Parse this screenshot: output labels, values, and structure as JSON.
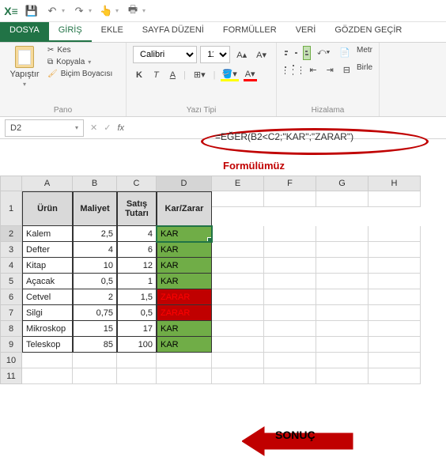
{
  "qat": {
    "save": "💾",
    "undo": "↶",
    "redo": "↷"
  },
  "tabs": {
    "dosya": "DOSYA",
    "giris": "GİRİŞ",
    "ekle": "EKLE",
    "sayfa": "SAYFA DÜZENİ",
    "formuller": "FORMÜLLER",
    "veri": "VERİ",
    "gozden": "GÖZDEN GEÇİR"
  },
  "ribbon": {
    "paste": "Yapıştır",
    "cut": "Kes",
    "copy": "Kopyala",
    "format_painter": "Biçim Boyacısı",
    "font_name": "Calibri",
    "font_size": "11",
    "merge": "Metr",
    "wrap": "Birle",
    "group_pano": "Pano",
    "group_font": "Yazı Tipi",
    "group_align": "Hizalama"
  },
  "namebox": "D2",
  "formula": "=EĞER(B2<C2;\"KAR\";\"ZARAR\")",
  "annotations": {
    "formula_label": "Formülümüz",
    "result_label": "SONUÇ"
  },
  "columns": [
    "A",
    "B",
    "C",
    "D",
    "E",
    "F",
    "G",
    "H"
  ],
  "header_row": {
    "urun": "Ürün",
    "maliyet": "Maliyet",
    "satis": "Satış Tutarı",
    "kz": "Kar/Zarar"
  },
  "rows": [
    {
      "n": 2,
      "urun": "Kalem",
      "maliyet": "2,5",
      "satis": "4",
      "kz": "KAR",
      "cls": "kar"
    },
    {
      "n": 3,
      "urun": "Defter",
      "maliyet": "4",
      "satis": "6",
      "kz": "KAR",
      "cls": "kar"
    },
    {
      "n": 4,
      "urun": "Kitap",
      "maliyet": "10",
      "satis": "12",
      "kz": "KAR",
      "cls": "kar"
    },
    {
      "n": 5,
      "urun": "Açacak",
      "maliyet": "0,5",
      "satis": "1",
      "kz": "KAR",
      "cls": "kar"
    },
    {
      "n": 6,
      "urun": "Cetvel",
      "maliyet": "2",
      "satis": "1,5",
      "kz": "ZARAR",
      "cls": "zarar"
    },
    {
      "n": 7,
      "urun": "Silgi",
      "maliyet": "0,75",
      "satis": "0,5",
      "kz": "ZARAR",
      "cls": "zarar"
    },
    {
      "n": 8,
      "urun": "Mikroskop",
      "maliyet": "15",
      "satis": "17",
      "kz": "KAR",
      "cls": "kar"
    },
    {
      "n": 9,
      "urun": "Teleskop",
      "maliyet": "85",
      "satis": "100",
      "kz": "KAR",
      "cls": "kar"
    }
  ]
}
